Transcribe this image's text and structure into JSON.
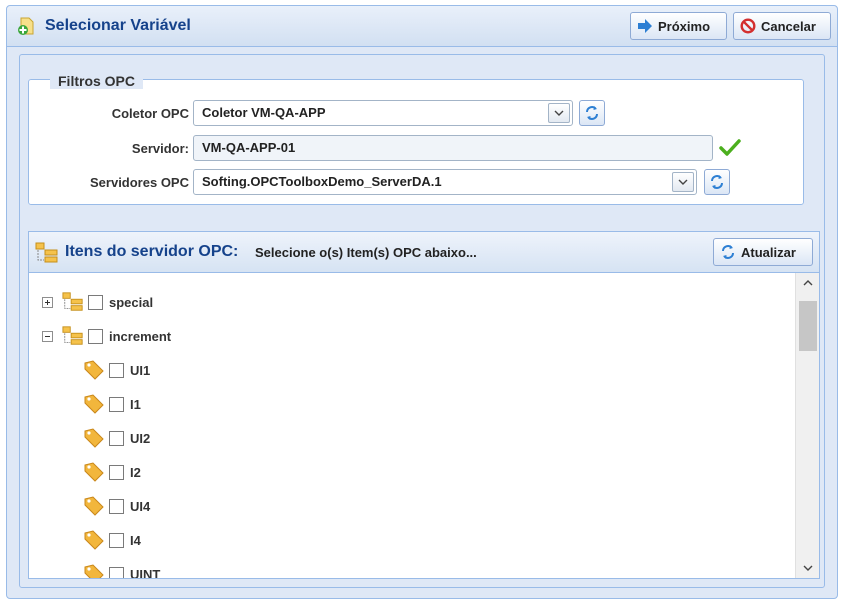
{
  "window": {
    "title": "Selecionar Variável",
    "next_label": "Próximo",
    "cancel_label": "Cancelar"
  },
  "filters": {
    "legend": "Filtros OPC",
    "collector": {
      "label": "Coletor OPC",
      "value": "Coletor VM-QA-APP"
    },
    "server": {
      "label": "Servidor:",
      "value": "VM-QA-APP-01"
    },
    "servers": {
      "label": "Servidores OPC",
      "value": "Softing.OPCToolboxDemo_ServerDA.1"
    }
  },
  "items_panel": {
    "title": "Itens do servidor OPC:",
    "subtitle": "Selecione o(s) Item(s) OPC abaixo...",
    "refresh_label": "Atualizar",
    "folders": [
      {
        "label": "special",
        "expanded": false
      },
      {
        "label": "increment",
        "expanded": true
      }
    ],
    "items": [
      "UI1",
      "I1",
      "UI2",
      "I2",
      "UI4",
      "I4",
      "UINT"
    ]
  },
  "colors": {
    "title_text": "#15428b",
    "border": "#99bbe8",
    "background": "#dfe8f6",
    "check_green": "#4caf1e",
    "cancel_red": "#d32f2f",
    "arrow_blue": "#2d7fd3",
    "tag_orange": "#f2b63c"
  }
}
